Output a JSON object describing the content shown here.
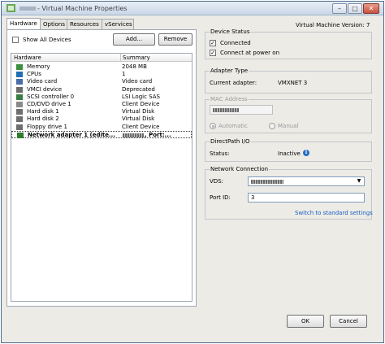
{
  "window": {
    "title": "- Virtual Machine Properties",
    "controls": [
      "–",
      "□",
      "✕"
    ]
  },
  "tabs": [
    "Hardware",
    "Options",
    "Resources",
    "vServices"
  ],
  "left": {
    "show_all_devices": "Show All Devices",
    "add_button": "Add...",
    "remove_button": "Remove",
    "columns": [
      "Hardware",
      "Summary"
    ],
    "rows": [
      {
        "name": "Memory",
        "summary": "2048 MB",
        "icon": "memory-icon",
        "color": "#3e8e41"
      },
      {
        "name": "CPUs",
        "summary": "1",
        "icon": "cpu-icon",
        "color": "#1f6fb3"
      },
      {
        "name": "Video card",
        "summary": "Video card",
        "icon": "video-card-icon",
        "color": "#4a6da8"
      },
      {
        "name": "VMCI device",
        "summary": "Deprecated",
        "icon": "vmci-icon",
        "color": "#6c6c6c"
      },
      {
        "name": "SCSI controller 0",
        "summary": "LSI Logic SAS",
        "icon": "scsi-icon",
        "color": "#3a7d44"
      },
      {
        "name": "CD/DVD drive 1",
        "summary": "Client Device",
        "icon": "cd-dvd-icon",
        "color": "#8a8a8a"
      },
      {
        "name": "Hard disk 1",
        "summary": "Virtual Disk",
        "icon": "hard-disk-icon",
        "color": "#6f6f6f"
      },
      {
        "name": "Hard disk 2",
        "summary": "Virtual Disk",
        "icon": "hard-disk-icon",
        "color": "#6f6f6f"
      },
      {
        "name": "Floppy drive 1",
        "summary": "Client Device",
        "icon": "floppy-icon",
        "color": "#6f6f6f"
      },
      {
        "name": "Network adapter 1 (edite...",
        "summary": ", Port:...",
        "icon": "network-adapter-icon",
        "color": "#2f7a2f"
      }
    ]
  },
  "right": {
    "vm_version": "Virtual Machine Version: 7",
    "device_status": {
      "title": "Device Status",
      "connected": "Connected",
      "connect_at_power_on": "Connect at power on",
      "check": "✓"
    },
    "adapter_type": {
      "title": "Adapter Type",
      "label": "Current adapter:",
      "value": "VMXNET 3"
    },
    "mac_address": {
      "title": "MAC Address",
      "automatic": "Automatic",
      "manual": "Manual"
    },
    "directpath": {
      "title": "DirectPath I/O",
      "label": "Status:",
      "value": "Inactive",
      "info": "i"
    },
    "network_connection": {
      "title": "Network Connection",
      "vds_label": "VDS:",
      "port_label": "Port ID:",
      "port_value": "3",
      "switch_link": "Switch to standard settings",
      "dropdown_arrow": "▼"
    }
  },
  "footer": {
    "ok": "OK",
    "cancel": "Cancel"
  }
}
